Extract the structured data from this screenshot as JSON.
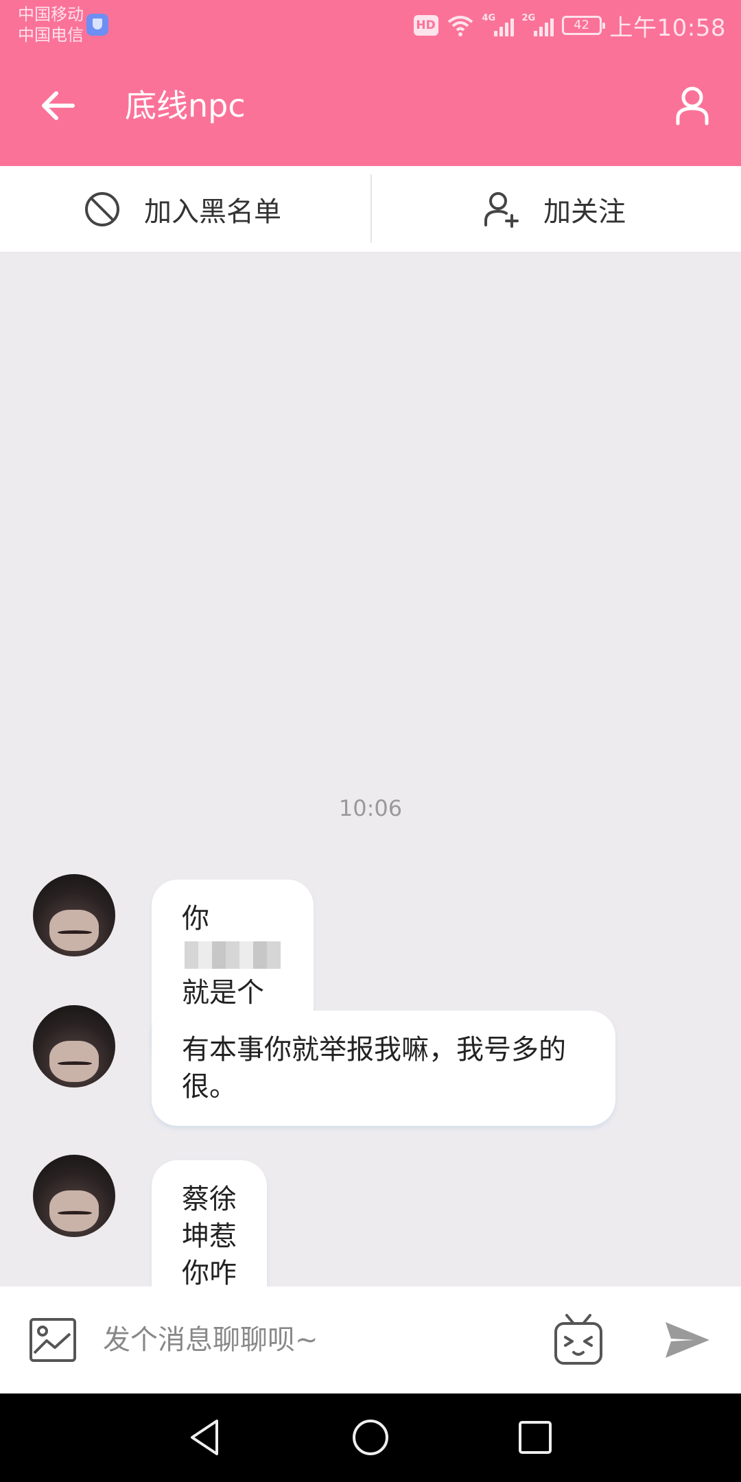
{
  "status_bar": {
    "carrier_1": "中国移动",
    "carrier_2": "中国电信",
    "hd": "HD",
    "net_1": "4G",
    "net_2": "2G",
    "battery": "42",
    "time": "上午10:58"
  },
  "app_bar": {
    "title": "底线npc",
    "back_icon": "arrow-left-icon",
    "profile_icon": "user-icon"
  },
  "actions": {
    "block_label": "加入黑名单",
    "follow_label": "加关注",
    "block_icon": "prohibited-icon",
    "follow_icon": "user-plus-icon"
  },
  "chat": {
    "timestamp": "10:06",
    "messages": [
      {
        "sender": "底线npc",
        "text_start": "你",
        "text_mid": "就是个",
        "text_blurred": true
      },
      {
        "sender": "底线npc",
        "text": "有本事你就举报我嘛，我号多的很。"
      },
      {
        "sender": "底线npc",
        "text": "蔡徐坤惹你咋滴啦？"
      }
    ]
  },
  "input": {
    "placeholder": "发个消息聊聊呗~",
    "image_icon": "image-icon",
    "emoji_icon": "tv-emoji-icon",
    "send_icon": "send-icon"
  },
  "nav_bar": {
    "back_icon": "triangle-back-icon",
    "home_icon": "circle-home-icon",
    "recents_icon": "square-recents-icon"
  },
  "colors": {
    "primary": "#fb7299",
    "chat_background": "#edebee",
    "bubble": "#ffffff"
  }
}
